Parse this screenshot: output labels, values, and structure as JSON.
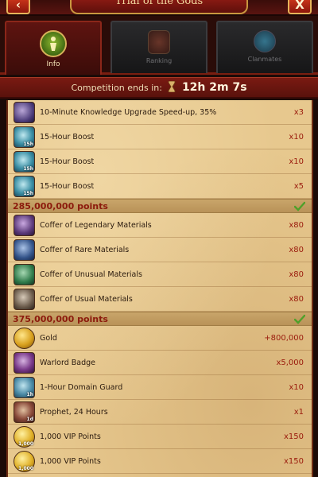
{
  "header": {
    "title": "Trial of the Gods",
    "back_label": "‹",
    "close_label": "X"
  },
  "tabs": [
    {
      "label": "Info",
      "icon": "info-icon",
      "active": true
    },
    {
      "label": "Ranking",
      "icon": "ranking-icon",
      "active": false
    },
    {
      "label": "Clanmates",
      "icon": "clanmates-icon",
      "active": false
    }
  ],
  "competition": {
    "label": "Competition ends in:",
    "timer": "12h 2m 7s"
  },
  "rows_a": [
    {
      "name": "10-Minute Knowledge Upgrade Speed-up, 35%",
      "qty": "x3",
      "icon": "book-icon",
      "badge": ""
    },
    {
      "name": "15-Hour Boost",
      "qty": "x10",
      "icon": "boost-icon",
      "badge": "15h"
    },
    {
      "name": "15-Hour Boost",
      "qty": "x10",
      "icon": "boost-icon",
      "badge": "15h"
    },
    {
      "name": "15-Hour Boost",
      "qty": "x5",
      "icon": "boost-icon",
      "badge": "15h"
    }
  ],
  "milestone_1": "285,000,000 points",
  "rows_b": [
    {
      "name": "Coffer of Legendary Materials",
      "qty": "x80",
      "icon": "coffer-icon"
    },
    {
      "name": "Coffer of Rare Materials",
      "qty": "x80",
      "icon": "coffer-icon"
    },
    {
      "name": "Coffer of Unusual Materials",
      "qty": "x80",
      "icon": "coffer-icon"
    },
    {
      "name": "Coffer of Usual Materials",
      "qty": "x80",
      "icon": "coffer-icon"
    }
  ],
  "milestone_2": "375,000,000 points",
  "rows_c": [
    {
      "name": "Gold",
      "qty": "+800,000",
      "icon": "gold-icon",
      "badge": ""
    },
    {
      "name": "Warlord Badge",
      "qty": "x5,000",
      "icon": "badge-icon",
      "badge": ""
    },
    {
      "name": "1-Hour Domain Guard",
      "qty": "x10",
      "icon": "guard-icon",
      "badge": "1h"
    },
    {
      "name": "Prophet, 24 Hours",
      "qty": "x1",
      "icon": "prophet-icon",
      "badge": "1d"
    },
    {
      "name": "1,000 VIP Points",
      "qty": "x150",
      "icon": "vip-icon",
      "badge": "1,000"
    },
    {
      "name": "1,000 VIP Points",
      "qty": "x150",
      "icon": "vip-icon",
      "badge": "1,000"
    }
  ],
  "colors": {
    "accent_red": "#9a1a0c",
    "parchment": "#e7c88e",
    "check_green": "#4fa02a"
  }
}
